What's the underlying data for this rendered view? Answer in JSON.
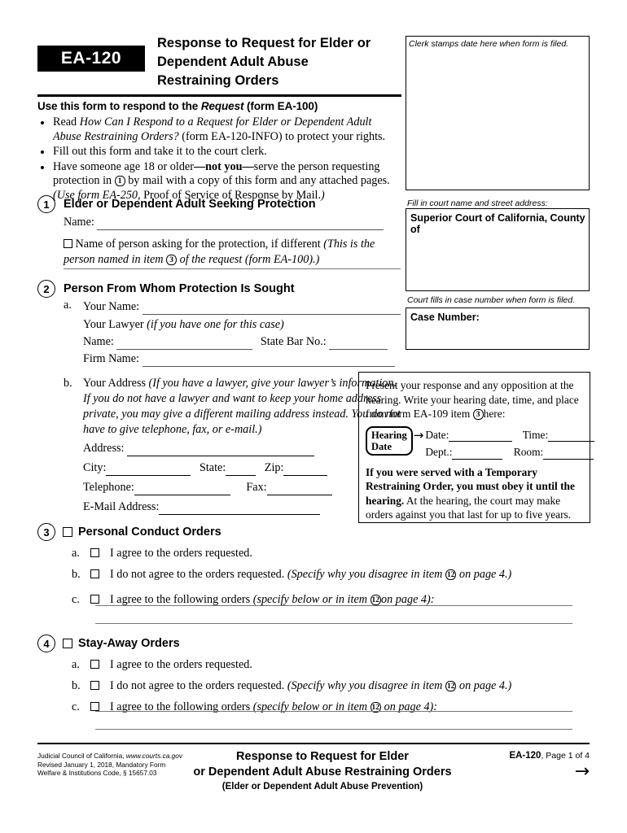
{
  "form": {
    "number": "EA-120",
    "title_lines": [
      "Response to Request for Elder or",
      "Dependent Adult Abuse",
      "Restraining Orders"
    ],
    "use_line_pre": "Use this form to respond to the ",
    "use_line_italic": "Request",
    "use_line_post": " (form EA-100)"
  },
  "instructions": [
    {
      "pre": "Read  ",
      "italic": "How Can I Respond to a Request for Elder or Dependent Adult Abuse Restraining Orders?",
      "post": " (form EA-120-INFO) to protect your rights."
    },
    {
      "pre": "Fill out this form and take it to the court clerk.",
      "italic": "",
      "post": ""
    },
    {
      "pre": "Have someone age 18 or older",
      "bold": "—not you—",
      "post": "serve the person requesting protection in",
      "circled": "1",
      "post2": "by mail with a copy of this form and any attached  pages.",
      "italic2": "(Use form EA-250,",
      "post3": " Proof of Service of Response by Mail.",
      "italic3": ")"
    }
  ],
  "right_column": {
    "clerk_caption": "Clerk stamps date here when form is filed.",
    "court_caption": "Fill in court name and street address:",
    "court_label": "Superior Court of California, County of",
    "case_caption": "Court fills in case number when form is filed.",
    "case_label": "Case Number:"
  },
  "section1": {
    "number": "1",
    "heading": "Elder or Dependent Adult Seeking Protection",
    "name_label": "Name:",
    "checkbox_text_pre": "Name of person asking for the protection, if different ",
    "checkbox_text_italic1": "(This is the person named in item ",
    "checkbox_circled": "3",
    "checkbox_text_italic2": " of the request (form EA-100).)"
  },
  "section2": {
    "number": "2",
    "heading": "Person From Whom Protection Is Sought",
    "a_letter": "a.",
    "your_name_label": "Your Name:",
    "your_lawyer_label": "Your Lawyer ",
    "your_lawyer_italic": "(if you have one for this case)",
    "lawyer_name_label": "Name:",
    "state_bar_label": "State Bar No.:",
    "firm_name_label": "Firm Name:",
    "b_letter": "b.",
    "your_address_label": "Your Address ",
    "your_address_italic": "(If you have a lawyer, give your lawyer’s information. If you do not have a lawyer and want to keep your home address private, you may give a different mailing address instead. You do not  have to give telephone, fax, or e-mail.)",
    "address_label": "Address:",
    "city_label": "City:",
    "state_label": "State:",
    "zip_label": "Zip:",
    "telephone_label": "Telephone:",
    "fax_label": "Fax:",
    "email_label": "E-Mail Address:"
  },
  "hearing": {
    "intro_pre": "Present your response and any opposition at the hearing. Write your hearing date, time, and place from form EA-109 item ",
    "intro_circled": "3",
    "intro_post": "here:",
    "badge_line1": "Hearing",
    "badge_line2": "Date",
    "arrow": "→",
    "date_label": "Date:",
    "time_label": "Time:",
    "dept_label": "Dept.:",
    "room_label": "Room:",
    "warn_bold": "If you were served with a Temporary Restraining Order, you must obey it until the hearing.",
    "warn_rest": " At the hearing, the court may make orders against you that last for up to five years."
  },
  "section3": {
    "number": "3",
    "heading": "Personal Conduct Orders",
    "items": [
      {
        "letter": "a.",
        "text": "I agree to the orders requested.",
        "italic": "",
        "circled": "",
        "italic2": ""
      },
      {
        "letter": "b.",
        "text": "I do not agree to the orders requested. ",
        "italic": "(Specify why you disagree in item ",
        "circled": "12",
        "italic2": " on page 4.)"
      },
      {
        "letter": "c.",
        "text": "I agree to the following orders ",
        "italic": "(specify below or in item ",
        "circled": "12",
        "italic2": "on page 4):"
      }
    ]
  },
  "section4": {
    "number": "4",
    "heading": "Stay-Away Orders",
    "items": [
      {
        "letter": "a.",
        "text": "I agree to the orders requested.",
        "italic": "",
        "circled": "",
        "italic2": ""
      },
      {
        "letter": "b.",
        "text": "I do not agree to the orders requested. ",
        "italic": "(Specify why you disagree in item ",
        "circled": "12",
        "italic2": " on page 4.)"
      },
      {
        "letter": "c.",
        "text": "I agree to the following orders ",
        "italic": "(specify below or in item ",
        "circled": "12",
        "italic2": " on page 4):"
      }
    ]
  },
  "footer": {
    "left_line1_pre": "Judicial Council of California, ",
    "left_line1_italic": "www.courts.ca.gov",
    "left_line2": "Revised January 1, 2018, Mandatory Form",
    "left_line3": "Welfare & Institutions Code, § 15657.03",
    "center_line1": "Response to Request for Elder",
    "center_line2": "or Dependent Adult Abuse Restraining Orders",
    "center_line3": "(Elder or Dependent Adult Abuse Prevention)",
    "right_form": "EA-120",
    "right_page": ", Page 1 of 4",
    "right_arrow": "→"
  },
  "colors": {
    "ink": "#000000",
    "rule": "#555555",
    "paper": "#ffffff"
  }
}
